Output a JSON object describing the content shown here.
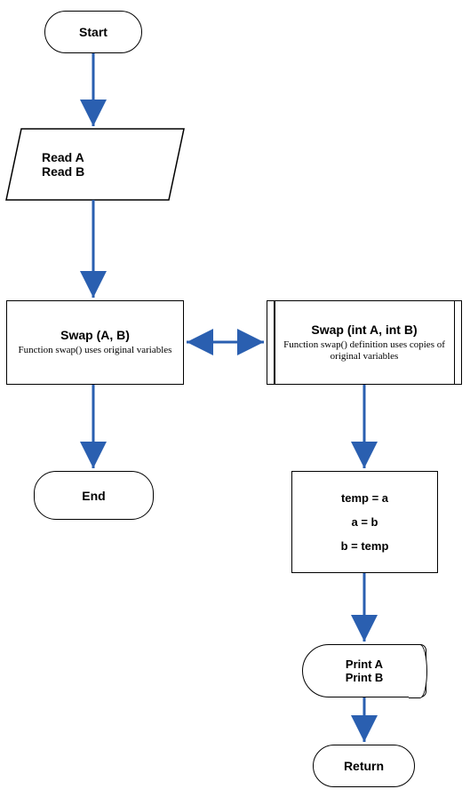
{
  "chart_data": {
    "type": "flowchart",
    "nodes": [
      {
        "id": "start",
        "type": "terminator",
        "label": "Start"
      },
      {
        "id": "read",
        "type": "io",
        "lines": [
          "Read A",
          "Read B"
        ]
      },
      {
        "id": "swap_call",
        "type": "process",
        "title": "Swap (A, B)",
        "subtitle": "Function swap() uses original variables"
      },
      {
        "id": "swap_def",
        "type": "predefined-process",
        "title": "Swap (int A, int B)",
        "subtitle": "Function swap() definition uses copies of original variables"
      },
      {
        "id": "end",
        "type": "terminator",
        "label": "End"
      },
      {
        "id": "swap_body",
        "type": "process",
        "lines": [
          "temp = a",
          "a = b",
          "b = temp"
        ]
      },
      {
        "id": "print",
        "type": "display",
        "lines": [
          "Print A",
          "Print B"
        ]
      },
      {
        "id": "return",
        "type": "terminator",
        "label": "Return"
      }
    ],
    "edges": [
      {
        "from": "start",
        "to": "read"
      },
      {
        "from": "read",
        "to": "swap_call"
      },
      {
        "from": "swap_call",
        "to": "swap_def",
        "bidirectional": true
      },
      {
        "from": "swap_call",
        "to": "end"
      },
      {
        "from": "swap_def",
        "to": "swap_body"
      },
      {
        "from": "swap_body",
        "to": "print"
      },
      {
        "from": "print",
        "to": "return"
      }
    ]
  },
  "nodes": {
    "start": {
      "label": "Start"
    },
    "read": {
      "line1": "Read A",
      "line2": "Read B"
    },
    "swap_call": {
      "title": "Swap (A, B)",
      "sub": "Function swap() uses original variables"
    },
    "swap_def": {
      "title": "Swap (int A, int B)",
      "sub": "Function swap() definition uses copies of original variables"
    },
    "end": {
      "label": "End"
    },
    "swap_body": {
      "l1": "temp = a",
      "l2": "a = b",
      "l3": "b = temp"
    },
    "print": {
      "l1": "Print A",
      "l2": "Print B"
    },
    "return": {
      "label": "Return"
    }
  },
  "colors": {
    "arrow": "#2a5fb0"
  }
}
